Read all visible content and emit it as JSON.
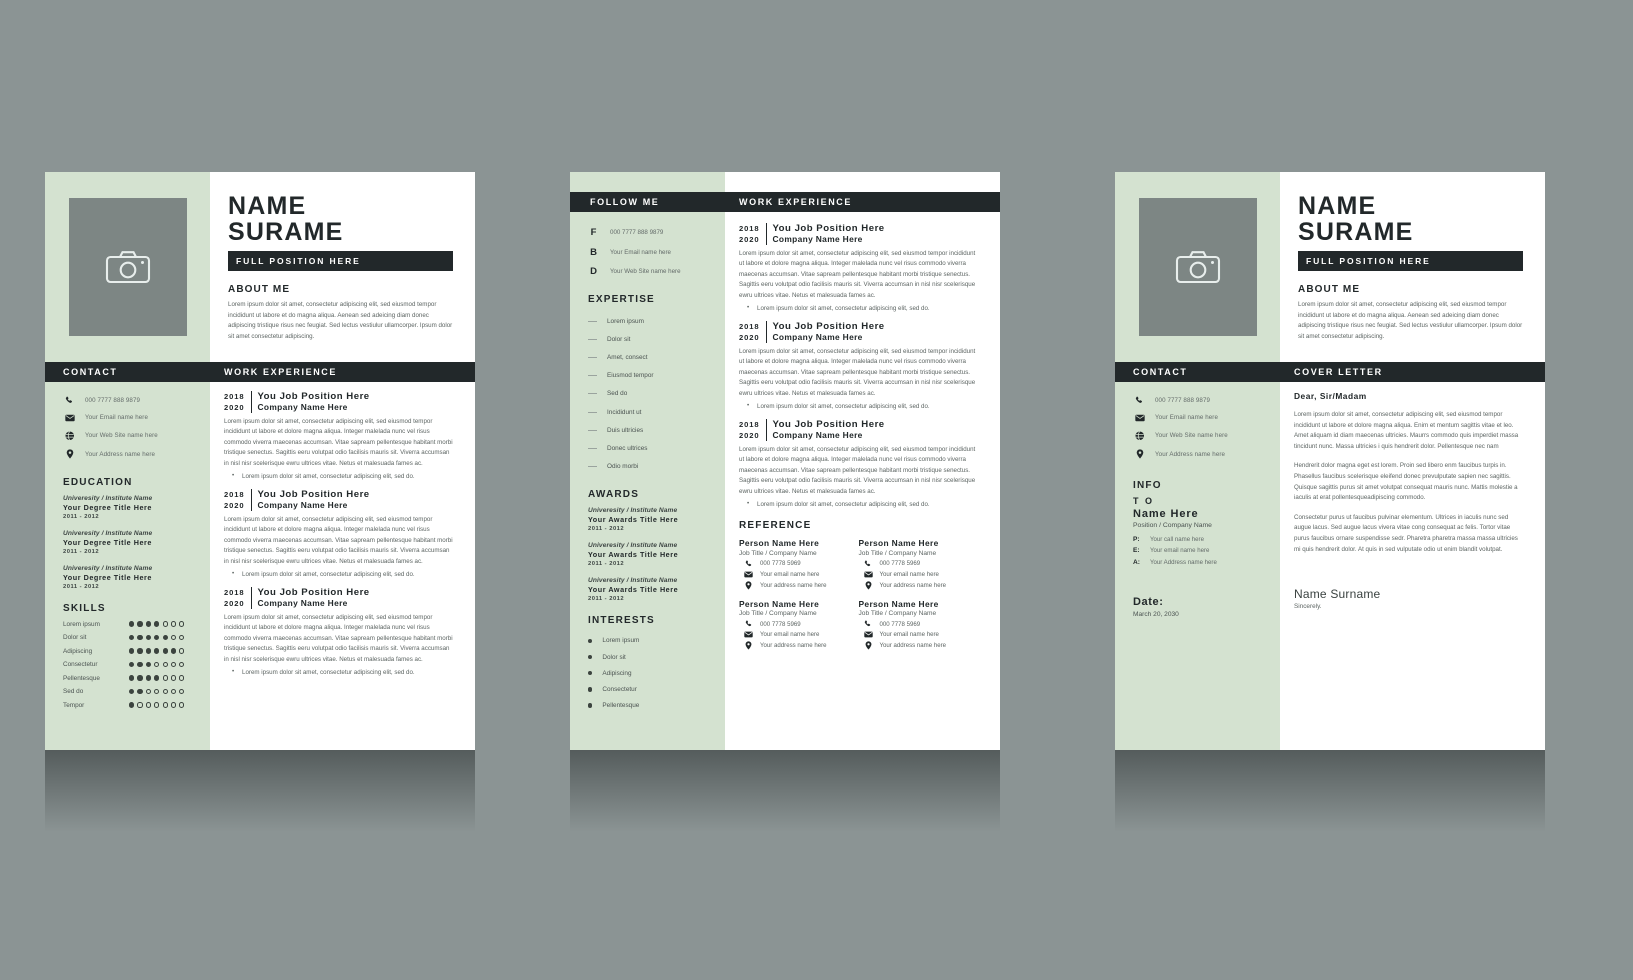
{
  "theme": {
    "canvas_bg": "#8b9494",
    "accent_green": "#d4e2d0",
    "dark": "#22282a",
    "photo_gray": "#7d8684",
    "body_text": "#5d6563"
  },
  "resume": {
    "name_line1": "NAME",
    "name_line2": "SURAME",
    "position": "FULL POSITION HERE",
    "about_heading": "ABOUT ME",
    "about_text": "Lorem ipsum dolor sit amet, consectetur adipiscing elit, sed eiusmod tempor incididunt ut labore et do magna aliqua. Aenean sed adeicing diam donec adipiscing tristique risus nec feugiat. Sed lectus vestiulur ullamcorper. Ipsum dolor sit amet consectetur adipiscing.",
    "photo_icon": "camera-icon"
  },
  "page1": {
    "contact_bar": "CONTACT",
    "work_bar": "WORK EXPERIENCE",
    "contact": [
      {
        "icon": "phone-icon",
        "text": "000 7777 888 9879"
      },
      {
        "icon": "envelope-icon",
        "text": "Your Email name here"
      },
      {
        "icon": "globe-icon",
        "text": "Your Web Site name here"
      },
      {
        "icon": "location-pin-icon",
        "text": "Your Address name here"
      }
    ],
    "education_heading": "EDUCATION",
    "education": [
      {
        "institute": "Univeresity / Institute Name",
        "degree": "Your Degree Title Here",
        "years": "2011 - 2012"
      },
      {
        "institute": "Univeresity / Institute Name",
        "degree": "Your Degree Title Here",
        "years": "2011 - 2012"
      },
      {
        "institute": "Univeresity / Institute Name",
        "degree": "Your Degree Title Here",
        "years": "2011 - 2012"
      }
    ],
    "skills_heading": "SKILLS",
    "skills": [
      {
        "label": "Lorem ipsum",
        "filled": 4,
        "total": 7
      },
      {
        "label": "Dolor sit",
        "filled": 5,
        "total": 7
      },
      {
        "label": "Adipiscing",
        "filled": 6,
        "total": 7
      },
      {
        "label": "Consectetur",
        "filled": 3,
        "total": 7
      },
      {
        "label": "Pellentesque",
        "filled": 4,
        "total": 7
      },
      {
        "label": "Sed do",
        "filled": 2,
        "total": 7
      },
      {
        "label": "Tempor",
        "filled": 1,
        "total": 7
      }
    ],
    "jobs": [
      {
        "year_from": "2018",
        "year_to": "2020",
        "title": "You Job Position Here",
        "company": "Company Name Here",
        "text": "Lorem ipsum dolor sit amet, consectetur adipiscing elit, sed eiusmod tempor incididunt ut labore et dolore magna aliqua. Integer malelada nunc vel risus commodo viverra maecenas accumsan. Vitae sapream pellentesque habitant morbi tristique senectus. Sagittis eeru volutpat odio facilisis mauris sit. Viverra accumsan in nisl nisr scelerisque ewru ultrices vitae. Netus et malesuada fames ac.",
        "bullet": "Lorem ipsum dolor sit amet, consectetur adipiscing elit, sed do."
      },
      {
        "year_from": "2018",
        "year_to": "2020",
        "title": "You Job Position Here",
        "company": "Company Name Here",
        "text": "Lorem ipsum dolor sit amet, consectetur adipiscing elit, sed eiusmod tempor incididunt ut labore et dolore magna aliqua. Integer malelada nunc vel risus commodo viverra maecenas accumsan. Vitae sapream pellentesque habitant morbi tristique senectus. Sagittis eeru volutpat odio facilisis mauris sit. Viverra accumsan in nisl nisr scelerisque ewru ultrices vitae. Netus et malesuada fames ac.",
        "bullet": "Lorem ipsum dolor sit amet, consectetur adipiscing elit, sed do."
      },
      {
        "year_from": "2018",
        "year_to": "2020",
        "title": "You Job Position Here",
        "company": "Company Name Here",
        "text": "Lorem ipsum dolor sit amet, consectetur adipiscing elit, sed eiusmod tempor incididunt ut labore et dolore magna aliqua. Integer malelada nunc vel risus commodo viverra maecenas accumsan. Vitae sapream pellentesque habitant morbi tristique senectus. Sagittis eeru volutpat odio facilisis mauris sit. Viverra accumsan in nisl nisr scelerisque ewru ultrices vitae. Netus et malesuada fames ac.",
        "bullet": "Lorem ipsum dolor sit amet, consectetur adipiscing elit, sed do."
      }
    ]
  },
  "page2": {
    "follow_bar": "FOLLOW ME",
    "work_bar": "WORK EXPERIENCE",
    "follow": [
      {
        "glyph": "F",
        "icon": "facebook-letter-icon",
        "text": "000 7777 888 9879"
      },
      {
        "glyph": "B",
        "icon": "behance-letter-icon",
        "text": "Your Email name here"
      },
      {
        "glyph": "D",
        "icon": "dribbble-letter-icon",
        "text": "Your Web Site name here"
      }
    ],
    "expertise_heading": "EXPERTISE",
    "expertise": [
      "Lorem ipsum",
      "Dolor sit",
      "Amet, consect",
      "Eiusmod tempor",
      "Sed do",
      "Incididunt ut",
      "Duis ultricies",
      "Donec ultrices",
      "Odio morbi"
    ],
    "awards_heading": "AWARDS",
    "awards": [
      {
        "institute": "Univeresity / Institute Name",
        "title": "Your Awards Title Here",
        "years": "2011 - 2012"
      },
      {
        "institute": "Univeresity / Institute Name",
        "title": "Your Awards Title Here",
        "years": "2011 - 2012"
      },
      {
        "institute": "Univeresity / Institute Name",
        "title": "Your Awards Title Here",
        "years": "2011 - 2012"
      }
    ],
    "interests_heading": "INTERESTS",
    "interests": [
      "Lorem ipsum",
      "Dolor sit",
      "Adipiscing",
      "Consectetur",
      "Pellentesque"
    ],
    "jobs": [
      {
        "year_from": "2018",
        "year_to": "2020",
        "title": "You Job Position Here",
        "company": "Company Name Here",
        "text": "Lorem ipsum dolor sit amet, consectetur adipiscing elit, sed eiusmod tempor incididunt ut labore et dolore magna aliqua. Integer malelada nunc vel risus commodo viverra maecenas accumsan. Vitae sapream pellentesque habitant morbi tristique senectus. Sagittis eeru volutpat odio facilisis mauris sit. Viverra accumsan in nisl nisr scelerisque ewru ultrices vitae. Netus et malesuada fames ac.",
        "bullet": "Lorem ipsum dolor sit amet, consectetur adipiscing elit, sed do."
      },
      {
        "year_from": "2018",
        "year_to": "2020",
        "title": "You Job Position Here",
        "company": "Company Name Here",
        "text": "Lorem ipsum dolor sit amet, consectetur adipiscing elit, sed eiusmod tempor incididunt ut labore et dolore magna aliqua. Integer malelada nunc vel risus commodo viverra maecenas accumsan. Vitae sapream pellentesque habitant morbi tristique senectus. Sagittis eeru volutpat odio facilisis mauris sit. Viverra accumsan in nisl nisr scelerisque ewru ultrices vitae. Netus et malesuada fames ac.",
        "bullet": "Lorem ipsum dolor sit amet, consectetur adipiscing elit, sed do."
      },
      {
        "year_from": "2018",
        "year_to": "2020",
        "title": "You Job Position Here",
        "company": "Company Name Here",
        "text": "Lorem ipsum dolor sit amet, consectetur adipiscing elit, sed eiusmod tempor incididunt ut labore et dolore magna aliqua. Integer malelada nunc vel risus commodo viverra maecenas accumsan. Vitae sapream pellentesque habitant morbi tristique senectus. Sagittis eeru volutpat odio facilisis mauris sit. Viverra accumsan in nisl nisr scelerisque ewru ultrices vitae. Netus et malesuada fames ac.",
        "bullet": "Lorem ipsum dolor sit amet, consectetur adipiscing elit, sed do."
      }
    ],
    "reference_heading": "REFERENCE",
    "references": [
      {
        "name": "Person Name Here",
        "job": "Job Title / Company Name",
        "phone": "000 7778 5969",
        "email": "Your email name here",
        "address": "Your address name here"
      },
      {
        "name": "Person Name Here",
        "job": "Job Title / Company Name",
        "phone": "000 7778 5969",
        "email": "Your email name here",
        "address": "Your address name here"
      },
      {
        "name": "Person Name Here",
        "job": "Job Title / Company Name",
        "phone": "000 7778 5969",
        "email": "Your email name here",
        "address": "Your address name here"
      },
      {
        "name": "Person Name Here",
        "job": "Job Title / Company Name",
        "phone": "000 7778 5969",
        "email": "Your email name here",
        "address": "Your address name here"
      }
    ]
  },
  "page3": {
    "contact_bar": "CONTACT",
    "cover_bar": "COVER LETTER",
    "contact": [
      {
        "icon": "phone-icon",
        "text": "000 7777 888 9879"
      },
      {
        "icon": "envelope-icon",
        "text": "Your Email name here"
      },
      {
        "icon": "globe-icon",
        "text": "Your Web Site name here"
      },
      {
        "icon": "location-pin-icon",
        "text": "Your Address name here"
      }
    ],
    "info_heading": "INFO",
    "to_label": "T O",
    "to_name": "Name Here",
    "to_position": "Position / Company Name",
    "to_fields": [
      {
        "key": "P:",
        "value": "Your  call name here"
      },
      {
        "key": "E:",
        "value": "Your  email name here"
      },
      {
        "key": "A:",
        "value": "Your  Address name here"
      }
    ],
    "date_label": "Date:",
    "date_value": "March 20, 2030",
    "greeting": "Dear, Sir/Madam",
    "paragraphs": [
      "Lorem ipsum dolor sit amet, consectetur adipiscing elit, sed eiusmod tempor incididunt ut labore et dolore magna aliqua. Enim et mentum sagittis vitae et leo. Amet aliquam id diam maecenas ultricies. Maurrs commodo quis imperdiet massa tincidunt nunc. Massa ultricies i quis hendrerit dolor. Pellentesque nec nam",
      "Hendrerit dolor magna eget est lorem. Proin sed libero enm faucibus turpis in. Phasellus faucibus scelerisque eleifend donec prevulputate sapien nec sagittis. Quisque sagittis purus sit amet volutpat consequat mauris nunc. Mattis molestie a iaculis at erat pollentesqueadipiscing commodo.",
      "Consectetur purus ut faucibus pulvinar elementum. Ultrices in iaculis nunc sed augue lacus. Sed augue lacus vivera vitae cong consequat ac felis. Tortor vitae purus faucibus ornare suspendisse sedr. Pharetra pharetra massa massa ultricies mi quis hendrerit dolor. At quis in sed vulputate odio ut enim blandit volutpat."
    ],
    "signature_name": "Name Surname",
    "signature_sub": "Sincerely."
  }
}
